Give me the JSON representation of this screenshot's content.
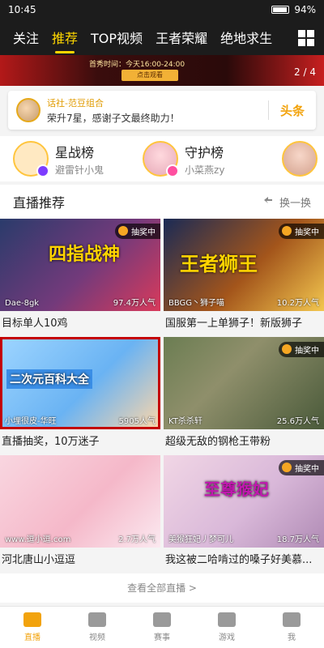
{
  "status": {
    "time": "10:45",
    "battery": "94%",
    "battery_level": 0.94
  },
  "nav": {
    "tabs": [
      "关注",
      "推荐",
      "TOP视频",
      "王者荣耀",
      "绝地求生"
    ],
    "active_index": 1
  },
  "banner": {
    "title_text": "首秀时间：今天16:00-24:00",
    "button": "点击观看",
    "counter": "2 / 4"
  },
  "notice": {
    "line1": "话社-范豆组合",
    "line2": "荣升7星，感谢子文最终助力！",
    "brand": "头条"
  },
  "rank": [
    {
      "title": "星战榜",
      "sub": "避雷针小鬼"
    },
    {
      "title": "守护榜",
      "sub": "小菜燕zy"
    }
  ],
  "section": {
    "title": "直播推荐",
    "refresh": "换一换"
  },
  "cards": [
    {
      "title": "目标单人10鸡",
      "streamer": "Dae-8gk",
      "viewers": "97.4万人气",
      "lottery": "抽奖中",
      "overlay": "四指战神"
    },
    {
      "title": "国服第一上单狮子！新版狮子",
      "streamer": "BBGG丶狮子喵",
      "viewers": "10.2万人气",
      "lottery": "抽奖中",
      "overlay": "王者狮王"
    },
    {
      "title": "直播抽奖，10万迷子",
      "streamer": "小埋很皮-华旺",
      "viewers": "5905人气",
      "lottery": "",
      "overlay": "二次元百科大全"
    },
    {
      "title": "超级无敌的钢枪王带粉",
      "streamer": "KT杀杀轩",
      "viewers": "25.6万人气",
      "lottery": "抽奖中",
      "overlay": ""
    },
    {
      "title": "河北唐山小逗逗",
      "streamer": "www.逗小逗.com",
      "viewers": "2.7万人气",
      "lottery": "",
      "overlay": ""
    },
    {
      "title": "我这被二哈啃过的嗓子好美慕...",
      "streamer": "美猴狂妃丿梦可儿",
      "viewers": "18.7万人气",
      "lottery": "抽奖中",
      "overlay": "至尊猴妃"
    }
  ],
  "more": {
    "label": "查看全部直播 >"
  },
  "bottom_nav": [
    "直播",
    "视频",
    "赛事",
    "游戏",
    "我"
  ]
}
